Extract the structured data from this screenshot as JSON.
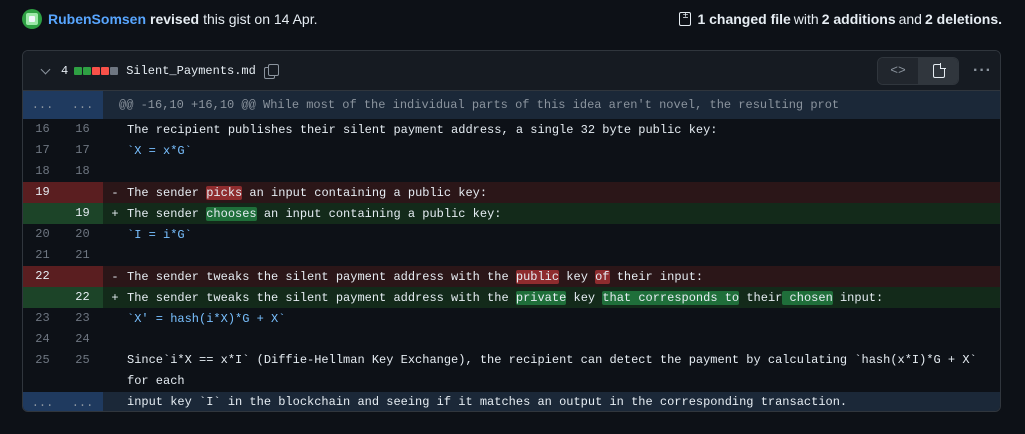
{
  "header": {
    "author": "RubenSomsen",
    "action": "revised",
    "meta": "this gist on 14 Apr.",
    "changed_files": "1 changed file",
    "with_text": "with",
    "additions": "2 additions",
    "and_text": "and",
    "deletions": "2 deletions."
  },
  "file": {
    "count": "4",
    "name": "Silent_Payments.md",
    "blocks": [
      "#2ea043",
      "#2ea043",
      "#f85149",
      "#f85149",
      "#6e7681"
    ],
    "code_btn": "<>",
    "more_icon": "···"
  },
  "hunk": {
    "left": "...",
    "right": "...",
    "text": "@@ -16,10 +16,10 @@ While most of the individual parts of this idea aren't novel, the resulting prot"
  },
  "lines": [
    {
      "type": "ctx",
      "old": "16",
      "new": "16",
      "parts": [
        "The recipient publishes their silent payment address, a single 32 byte public key:"
      ]
    },
    {
      "type": "ctx",
      "old": "17",
      "new": "17",
      "tick": "`X = x*G`"
    },
    {
      "type": "ctx",
      "old": "18",
      "new": "18",
      "parts": [
        ""
      ]
    },
    {
      "type": "del",
      "old": "19",
      "new": "",
      "sign": "-",
      "segs": [
        [
          "The sender ",
          false
        ],
        [
          "picks",
          true
        ],
        [
          " an input containing a public key:",
          false
        ]
      ]
    },
    {
      "type": "add",
      "old": "",
      "new": "19",
      "sign": "+",
      "segs": [
        [
          "The sender ",
          false
        ],
        [
          "chooses",
          true
        ],
        [
          " an input containing a public key:",
          false
        ]
      ]
    },
    {
      "type": "ctx",
      "old": "20",
      "new": "20",
      "tick": "`I = i*G`"
    },
    {
      "type": "ctx",
      "old": "21",
      "new": "21",
      "parts": [
        ""
      ]
    },
    {
      "type": "del",
      "old": "22",
      "new": "",
      "sign": "-",
      "segs": [
        [
          "The sender tweaks the silent payment address with the ",
          false
        ],
        [
          "public",
          true
        ],
        [
          " key ",
          false
        ],
        [
          "of",
          true
        ],
        [
          " their input:",
          false
        ]
      ]
    },
    {
      "type": "add",
      "old": "",
      "new": "22",
      "sign": "+",
      "segs": [
        [
          "The sender tweaks the silent payment address with the ",
          false
        ],
        [
          "private",
          true
        ],
        [
          " key ",
          false
        ],
        [
          "that corresponds to",
          true
        ],
        [
          " their",
          false
        ],
        [
          " chosen",
          true
        ],
        [
          " input:",
          false
        ]
      ]
    },
    {
      "type": "ctx",
      "old": "23",
      "new": "23",
      "tick": "`X' = hash(i*X)*G + X`"
    },
    {
      "type": "ctx",
      "old": "24",
      "new": "24",
      "parts": [
        ""
      ]
    },
    {
      "type": "tall",
      "old": "25",
      "new": "25",
      "text": "Since`i*X == x*I` (Diffie-Hellman Key Exchange), the recipient can detect the payment by calculating `hash(x*I)*G + X` for each\ninput key `I` in the blockchain and seeing if it matches an output in the corresponding transaction."
    }
  ],
  "footer": {
    "left": "...",
    "right": "..."
  }
}
